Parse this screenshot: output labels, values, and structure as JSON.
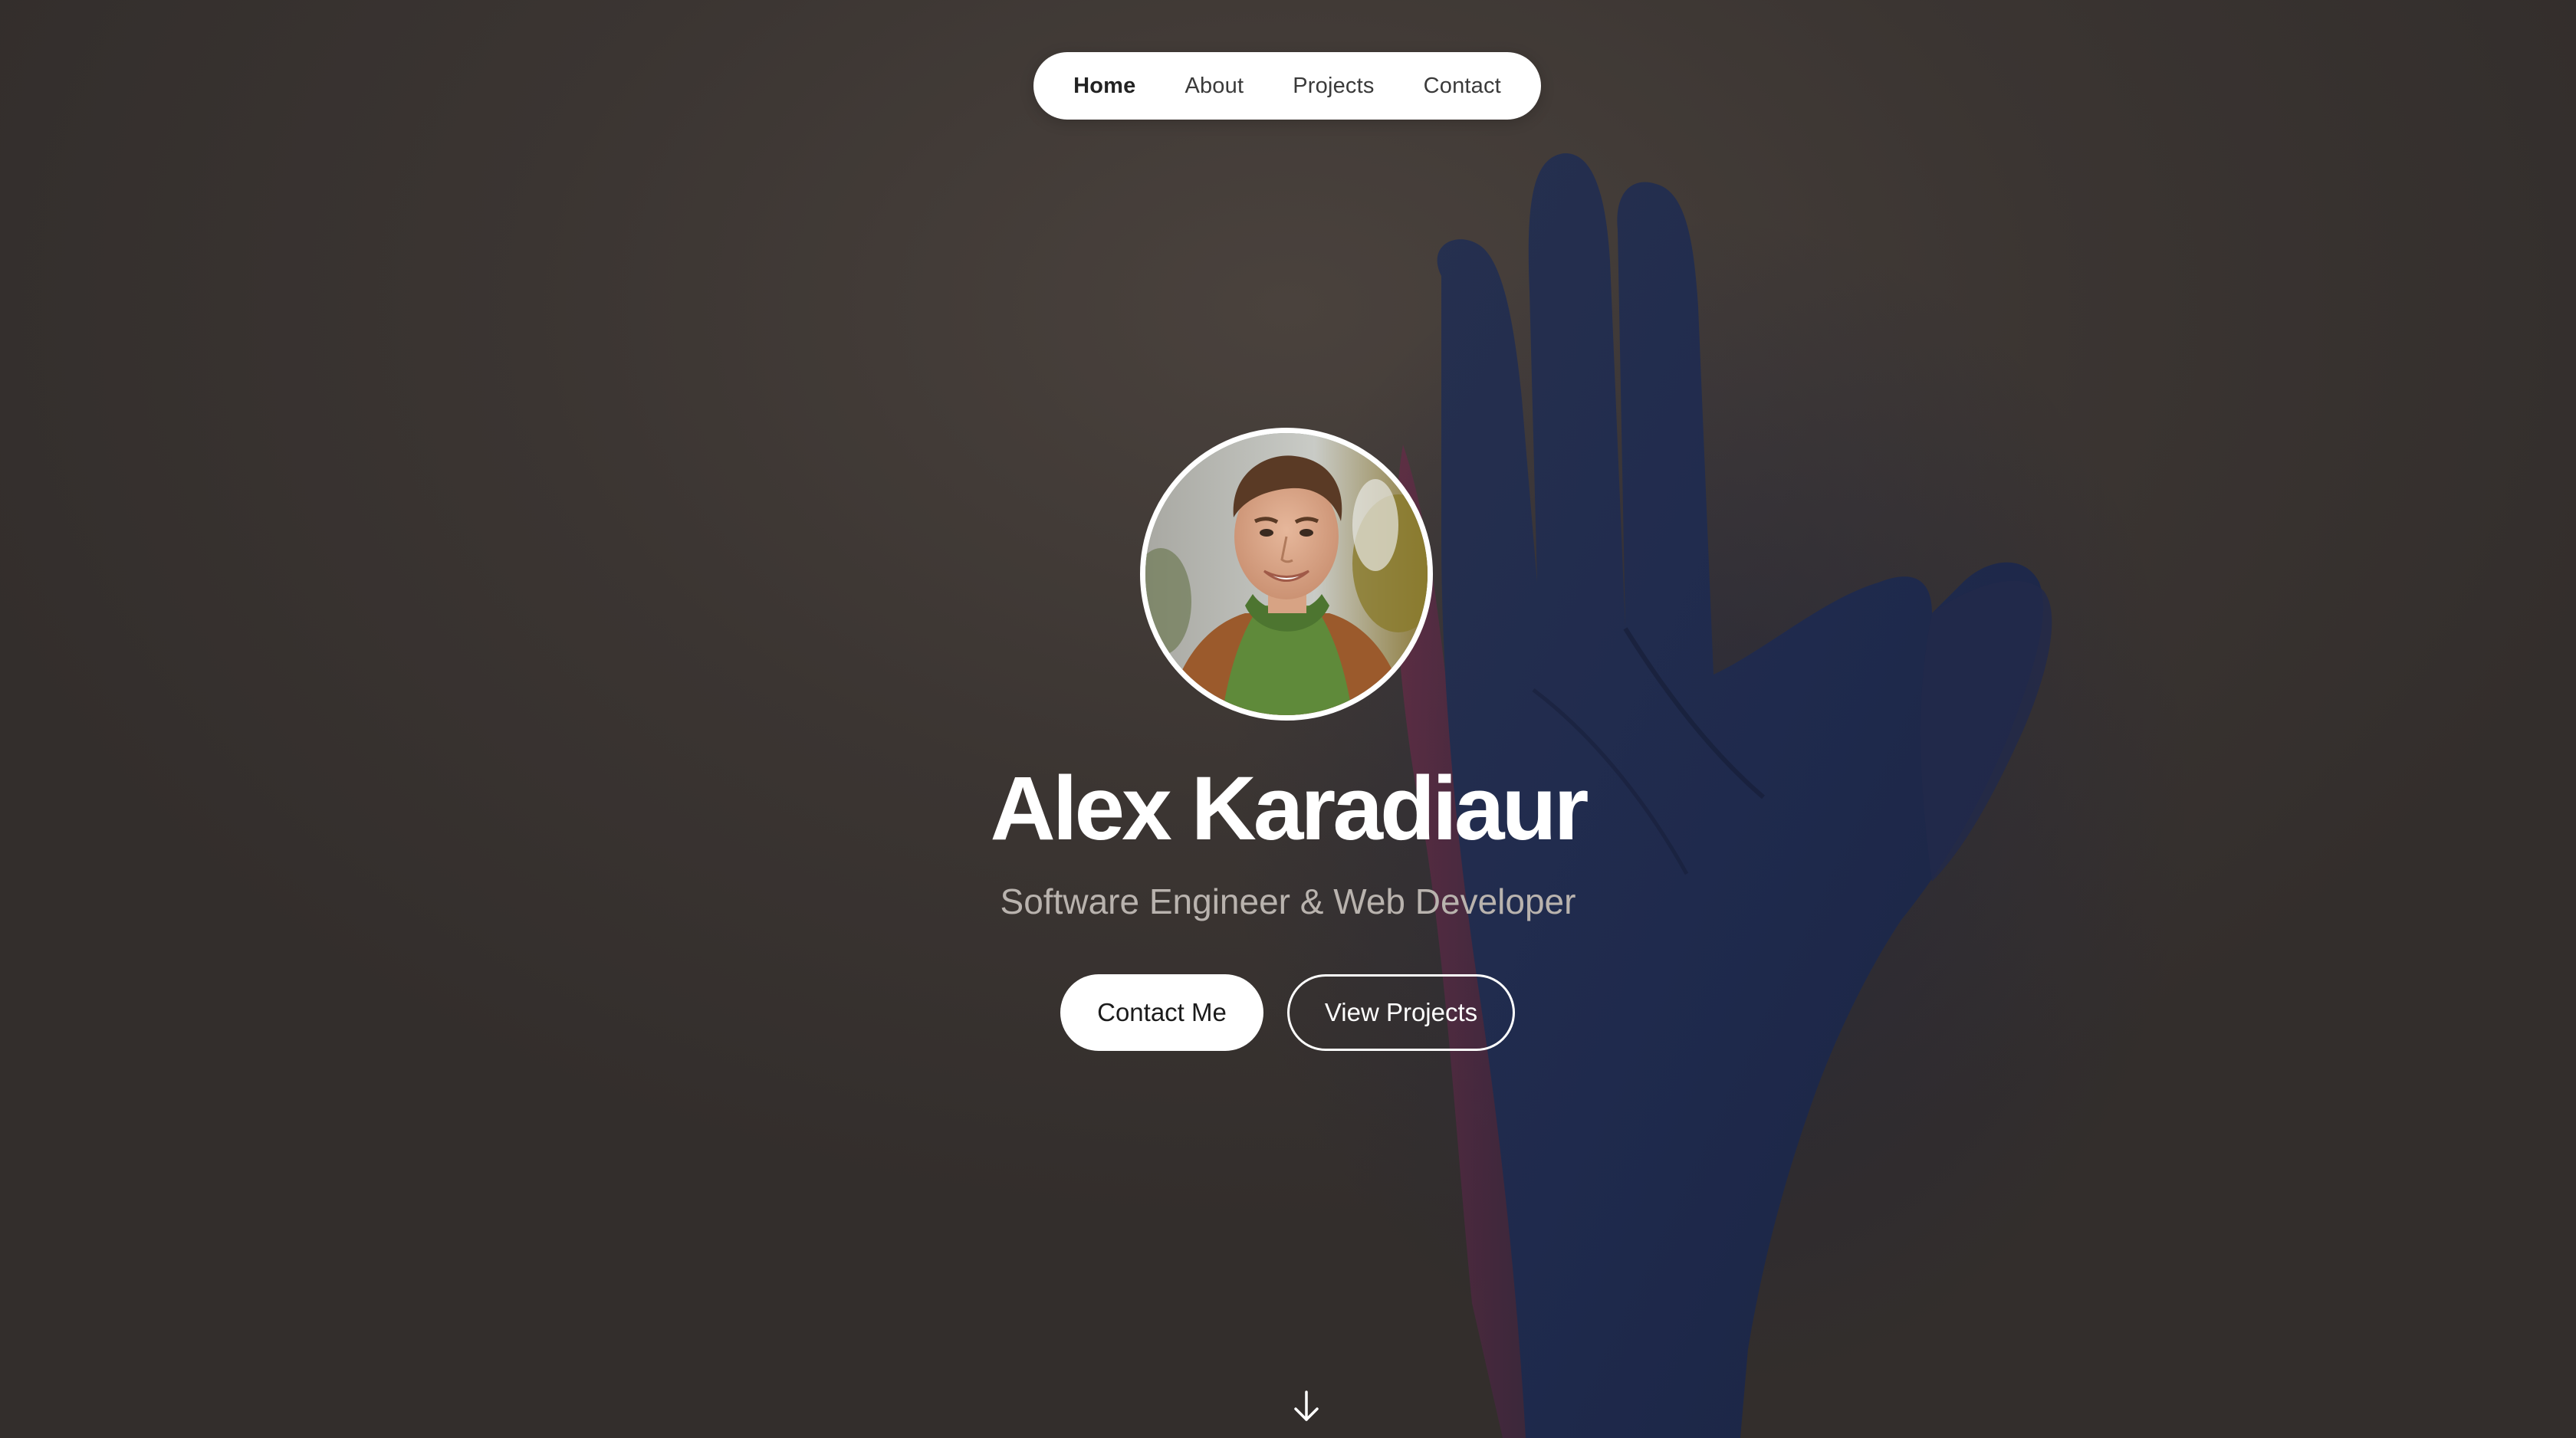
{
  "nav": {
    "items": [
      {
        "label": "Home",
        "active": true
      },
      {
        "label": "About",
        "active": false
      },
      {
        "label": "Projects",
        "active": false
      },
      {
        "label": "Contact",
        "active": false
      }
    ]
  },
  "hero": {
    "name": "Alex Karadiaur",
    "subtitle": "Software Engineer & Web Developer",
    "primary_button": "Contact Me",
    "secondary_button": "View Projects",
    "scroll_icon": "arrow-down-icon"
  },
  "colors": {
    "background": "#3b3532",
    "accent": "#ffffff",
    "subtitle": "#b9b3ae"
  }
}
